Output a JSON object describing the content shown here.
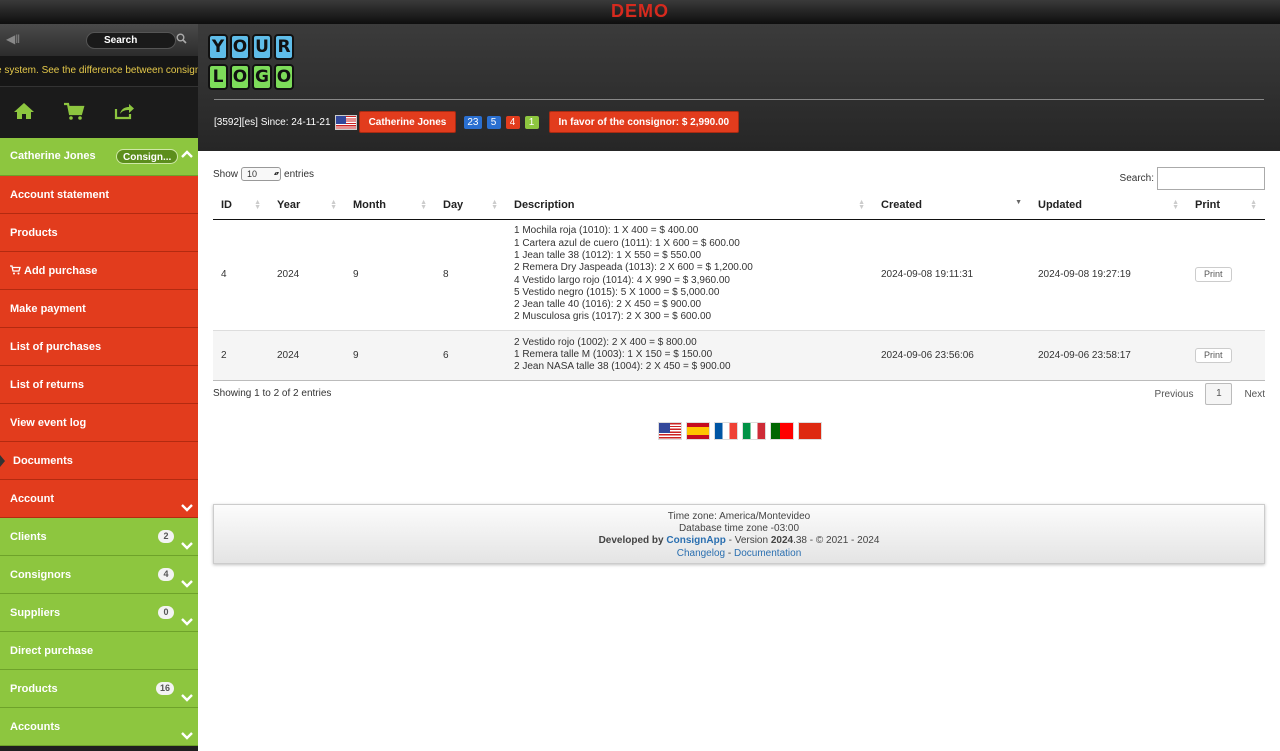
{
  "banner": {
    "text": "DEMO"
  },
  "sidebar": {
    "search_label": "Search",
    "marquee": "e system. See the difference between consignm",
    "icons": [
      "home-icon",
      "cart-icon",
      "share-icon"
    ],
    "user": {
      "name": "Catherine Jones",
      "role_pill": "Consign..."
    },
    "red_items": [
      {
        "label": "Account statement"
      },
      {
        "label": "Products"
      },
      {
        "label": "Add purchase"
      },
      {
        "label": "Make payment"
      },
      {
        "label": "List of purchases"
      },
      {
        "label": "List of returns"
      },
      {
        "label": "View event log"
      },
      {
        "label": "Documents"
      },
      {
        "label": "Account"
      }
    ],
    "green_items": [
      {
        "label": "Clients",
        "count": "2"
      },
      {
        "label": "Consignors",
        "count": "4"
      },
      {
        "label": "Suppliers",
        "count": "0"
      },
      {
        "label": "Direct purchase",
        "count": ""
      },
      {
        "label": "Products",
        "count": "16"
      },
      {
        "label": "Accounts",
        "count": ""
      }
    ]
  },
  "header": {
    "logo_top": [
      "Y",
      "O",
      "U",
      "R"
    ],
    "logo_bottom": [
      "L",
      "O",
      "G",
      "O"
    ],
    "account_info": "[3592][es] Since: 24-11-21",
    "user_button": "Catherine Jones",
    "badges": {
      "b1": "23",
      "b2": "5",
      "b3": "4",
      "b4": "1"
    },
    "balance_button": "In favor of the consignor: $ 2,990.00"
  },
  "table": {
    "show_label": "Show",
    "entries_label": "entries",
    "page_size": "10",
    "search_label": "Search:",
    "columns": [
      "ID",
      "Year",
      "Month",
      "Day",
      "Description",
      "Created",
      "Updated",
      "Print"
    ],
    "rows": [
      {
        "id": "4",
        "year": "2024",
        "month": "9",
        "day": "8",
        "description": [
          "1 Mochila roja (1010): 1 X 400 = $ 400.00",
          "1 Cartera azul de cuero (1011): 1 X 600 = $ 600.00",
          "1 Jean talle 38 (1012): 1 X 550 = $ 550.00",
          "2 Remera Dry Jaspeada (1013): 2 X 600 = $ 1,200.00",
          "4 Vestido largo rojo (1014): 4 X 990 = $ 3,960.00",
          "5 Vestido negro (1015): 5 X 1000 = $ 5,000.00",
          "2 Jean talle 40 (1016): 2 X 450 = $ 900.00",
          "2 Musculosa gris (1017): 2 X 300 = $ 600.00"
        ],
        "created": "2024-09-08 19:11:31",
        "updated": "2024-09-08 19:27:19",
        "print": "Print"
      },
      {
        "id": "2",
        "year": "2024",
        "month": "9",
        "day": "6",
        "description": [
          "2 Vestido rojo (1002): 2 X 400 = $ 800.00",
          "1 Remera talle M (1003): 1 X 150 = $ 150.00",
          "2 Jean NASA talle 38 (1004): 2 X 450 = $ 900.00"
        ],
        "created": "2024-09-06 23:56:06",
        "updated": "2024-09-06 23:58:17",
        "print": "Print"
      }
    ],
    "info": "Showing 1 to 2 of 2 entries",
    "pager": {
      "previous": "Previous",
      "page": "1",
      "next": "Next"
    }
  },
  "language_flags": [
    "us-flag",
    "es-flag",
    "fr-flag",
    "it-flag",
    "pt-flag",
    "cn-flag"
  ],
  "footer": {
    "timezone": "Time zone: America/Montevideo",
    "db_timezone": "Database time zone -03:00",
    "developed_by": "Developed by",
    "app_name": "ConsignApp",
    "version_prefix": "- Version",
    "version": "2024",
    "version_suffix": ".38 - © 2021 - 2024",
    "changelog": "Changelog",
    "sep": "-",
    "documentation": "Documentation"
  }
}
